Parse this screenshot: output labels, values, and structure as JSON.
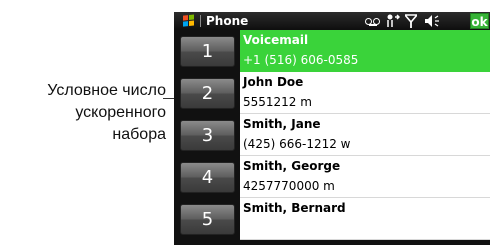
{
  "callout": {
    "lines": [
      "Условное число",
      "ускоренного",
      "набора"
    ]
  },
  "titlebar": {
    "title": "Phone",
    "icons": [
      "windows-logo-icon",
      "voicemail-icon",
      "network-icon",
      "signal-icon",
      "volume-icon"
    ],
    "ok_label": "ok",
    "colors": {
      "background": "#111111",
      "ok_button": "#36b336"
    }
  },
  "speed_dial": {
    "selected_index": 0,
    "selection_color": "#3ad33a",
    "entries": [
      {
        "key": "1",
        "name": "Voicemail",
        "number": "+1 (516) 606-0585"
      },
      {
        "key": "2",
        "name": "John Doe",
        "number": "5551212 m"
      },
      {
        "key": "3",
        "name": "Smith, Jane",
        "number": "(425) 666-1212 w"
      },
      {
        "key": "4",
        "name": "Smith, George",
        "number": "4257770000 m"
      },
      {
        "key": "5",
        "name": "Smith, Bernard",
        "number": ""
      }
    ]
  }
}
